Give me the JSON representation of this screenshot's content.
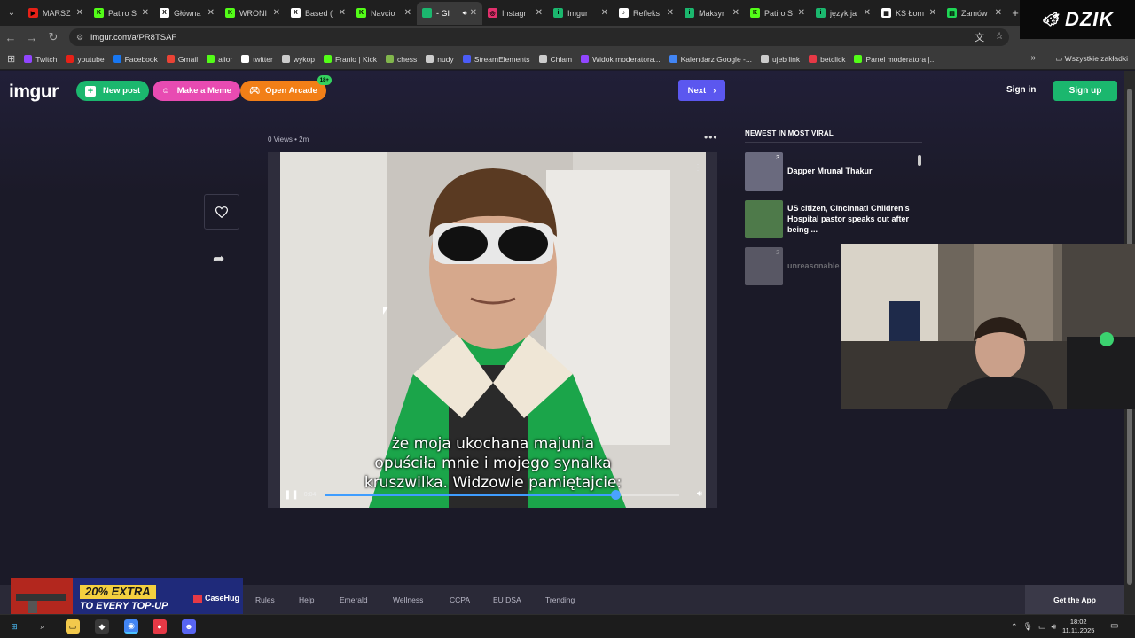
{
  "browser": {
    "tabs": [
      {
        "label": "MARSZ",
        "color": "#e62117",
        "glyph": "▶",
        "active": false
      },
      {
        "label": "Patiro S",
        "color": "#53fc18",
        "glyph": "K",
        "active": false
      },
      {
        "label": "Główna",
        "color": "#ffffff",
        "glyph": "X",
        "active": false
      },
      {
        "label": "WRONI",
        "color": "#53fc18",
        "glyph": "K",
        "active": false
      },
      {
        "label": "Based (",
        "color": "#ffffff",
        "glyph": "X",
        "active": false
      },
      {
        "label": "Navcio",
        "color": "#53fc18",
        "glyph": "K",
        "active": false
      },
      {
        "label": "- GI",
        "color": "#1bb76e",
        "glyph": "i",
        "active": true
      },
      {
        "label": "Instagr",
        "color": "#e1306c",
        "glyph": "◎",
        "active": false
      },
      {
        "label": "Imgur",
        "color": "#1bb76e",
        "glyph": "i",
        "active": false
      },
      {
        "label": "Refleks",
        "color": "#ffffff",
        "glyph": "♪",
        "active": false
      },
      {
        "label": "Maksyr",
        "color": "#1bb76e",
        "glyph": "i",
        "active": false
      },
      {
        "label": "Patiro S",
        "color": "#53fc18",
        "glyph": "K",
        "active": false
      },
      {
        "label": "język ja",
        "color": "#1bb76e",
        "glyph": "i",
        "active": false
      },
      {
        "label": "KS Łom",
        "color": "#ffffff",
        "glyph": "▦",
        "active": false
      },
      {
        "label": "Zamów",
        "color": "#1fd655",
        "glyph": "▤",
        "active": false
      }
    ],
    "url": "imgur.com/a/PR8TSAF",
    "bookmarks": [
      {
        "label": "Twitch",
        "color": "#9146ff"
      },
      {
        "label": "youtube",
        "color": "#e62117"
      },
      {
        "label": "Facebook",
        "color": "#1877f2"
      },
      {
        "label": "Gmail",
        "color": "#ea4335"
      },
      {
        "label": "alior",
        "color": "#53fc18"
      },
      {
        "label": "twitter",
        "color": "#ffffff"
      },
      {
        "label": "wykop",
        "color": "#cccccc"
      },
      {
        "label": "Franio | Kick",
        "color": "#53fc18"
      },
      {
        "label": "chess",
        "color": "#81b64c"
      },
      {
        "label": "nudy",
        "color": "#cccccc"
      },
      {
        "label": "StreamElements",
        "color": "#4b5cf6"
      },
      {
        "label": "Chłam",
        "color": "#cccccc"
      },
      {
        "label": "Widok moderatora...",
        "color": "#9146ff"
      },
      {
        "label": "Kalendarz Google -...",
        "color": "#4285f4"
      },
      {
        "label": "ujeb link",
        "color": "#cccccc"
      },
      {
        "label": "betclick",
        "color": "#e63946"
      },
      {
        "label": "Panel moderatora |...",
        "color": "#53fc18"
      }
    ],
    "all_bookmarks": "Wszystkie zakładki"
  },
  "overlay_brand": "DZIK",
  "imgur": {
    "logo": "imgur",
    "new_post": "New post",
    "make_meme": "Make a Meme",
    "open_arcade": "Open Arcade",
    "arcade_badge": "18+",
    "next": "Next",
    "sign_in": "Sign in",
    "sign_up": "Sign up",
    "meta": "0 Views • 2m",
    "video": {
      "subtitle_lines": [
        "że moja ukochana majunia",
        "opuściła mnie i mojego synalka",
        "kruszwilka. Widzowie pamiętajcie:"
      ],
      "time": "0:04",
      "progress": 0.82
    },
    "newest_title": "NEWEST IN MOST VIRAL",
    "posts": [
      {
        "title": "Dapper Mrunal Thakur",
        "count": "3",
        "color": "#6a6a7e"
      },
      {
        "title": "US citizen, Cincinnati Children's Hospital pastor speaks out after being ...",
        "count": "",
        "color": "#4e7a4a"
      },
      {
        "title": "unreasonable",
        "count": "2",
        "color": "#8a8a96"
      }
    ],
    "footer_links": [
      "Rules",
      "Help",
      "Emerald",
      "Wellness",
      "CCPA",
      "EU DSA",
      "Trending"
    ],
    "get_app": "Get the App"
  },
  "ad": {
    "line1": "20% EXTRA",
    "line2": "TO EVERY TOP-UP",
    "brand": "CaseHug"
  },
  "taskbar": {
    "time": "18:02",
    "date": "11.11.2025"
  }
}
